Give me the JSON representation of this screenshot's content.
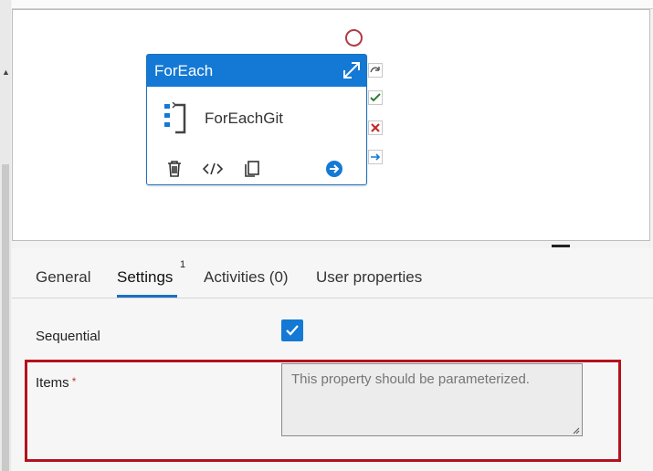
{
  "canvas": {
    "node": {
      "type_label": "ForEach",
      "name": "ForEachGit"
    }
  },
  "properties": {
    "tabs": [
      {
        "label": "General"
      },
      {
        "label": "Settings",
        "badge": "1"
      },
      {
        "label": "Activities (0)"
      },
      {
        "label": "User properties"
      }
    ],
    "active_tab": "Settings",
    "sequential": {
      "label": "Sequential",
      "checked": true
    },
    "items": {
      "label": "Items",
      "required_mark": "*",
      "placeholder": "This property should be parameterized."
    }
  },
  "colors": {
    "accent": "#1479d4",
    "highlight": "#b3121e",
    "success": "#2e7d32",
    "failure": "#c62828"
  },
  "icons": [
    "expand-icon",
    "foreach-icon",
    "delete-icon",
    "code-icon",
    "copy-icon",
    "navigate-arrow-icon",
    "skip-icon",
    "success-icon",
    "failure-icon",
    "completion-icon",
    "status-circle-icon"
  ]
}
